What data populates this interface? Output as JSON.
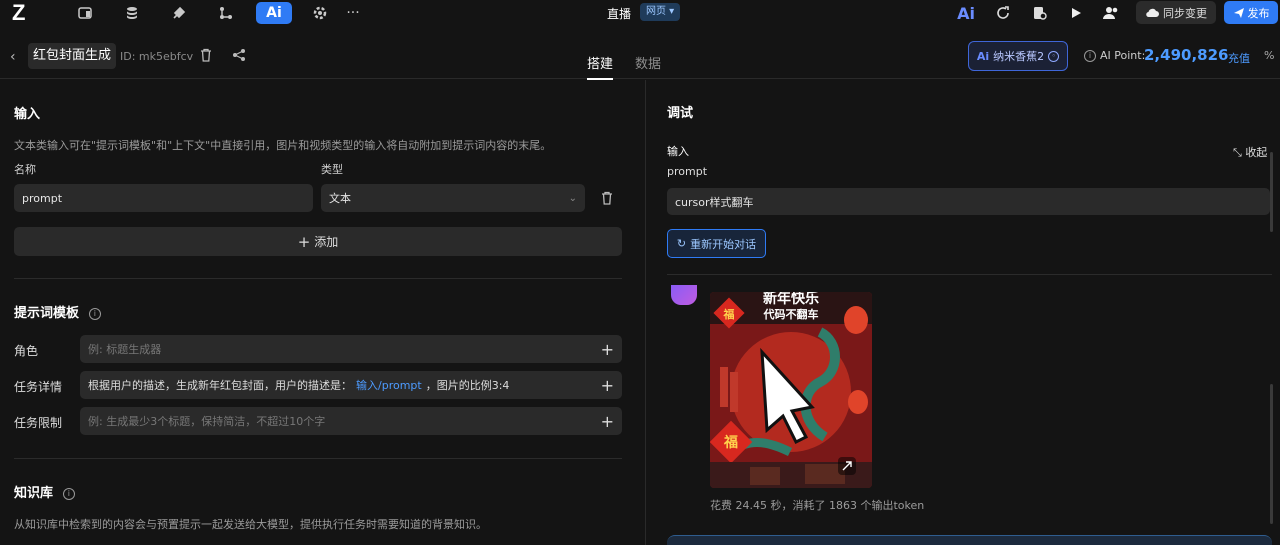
{
  "topbar": {
    "title": "直播",
    "badge": "网页 ▾",
    "sync_label": "同步变更",
    "publish_label": "发布",
    "ai_active_label": "Ai",
    "more_label": "···"
  },
  "header": {
    "app_name": "红包封面生成",
    "app_id": "ID: mk5ebfcv",
    "tabs": [
      {
        "label": "搭建",
        "active": true
      },
      {
        "label": "数据",
        "active": false
      }
    ],
    "model_label": "纳米香蕉2",
    "ai_point_label": "AI Point:",
    "ai_point_value": "2,490,826",
    "recharge_label": "充值"
  },
  "input_section": {
    "title": "输入",
    "description": "文本类输入可在\"提示词模板\"和\"上下文\"中直接引用，图片和视频类型的输入将自动附加到提示词内容的末尾。",
    "name_label": "名称",
    "type_label": "类型",
    "name_value": "prompt",
    "type_value": "文本",
    "add_label": "添加"
  },
  "prompt_template": {
    "title": "提示词模板",
    "role_label": "角色",
    "role_placeholder": "例: 标题生成器",
    "task_label": "任务详情",
    "task_text_before": "根据用户的描述，生成新年红包封面，用户的描述是：",
    "task_ref": "输入/prompt",
    "task_text_after": "，图片的比例3:4",
    "limit_label": "任务限制",
    "limit_placeholder": "例: 生成最少3个标题，保持简洁，不超过10个字"
  },
  "knowledge": {
    "title": "知识库",
    "description": "从知识库中检索到的内容会与预置提示一起发送给大模型，提供执行任务时需要知道的背景知识。"
  },
  "debug": {
    "title": "调试",
    "input_label": "输入",
    "collapse_label": "收起",
    "field_name": "prompt",
    "field_value": "cursor样式翻车",
    "restart_label": "重新开始对话",
    "poster_title": "新年快乐",
    "poster_subtitle": "代码不翻车",
    "poster_char": "福",
    "stats": "花费 24.45 秒，消耗了 1863 个输出token"
  }
}
